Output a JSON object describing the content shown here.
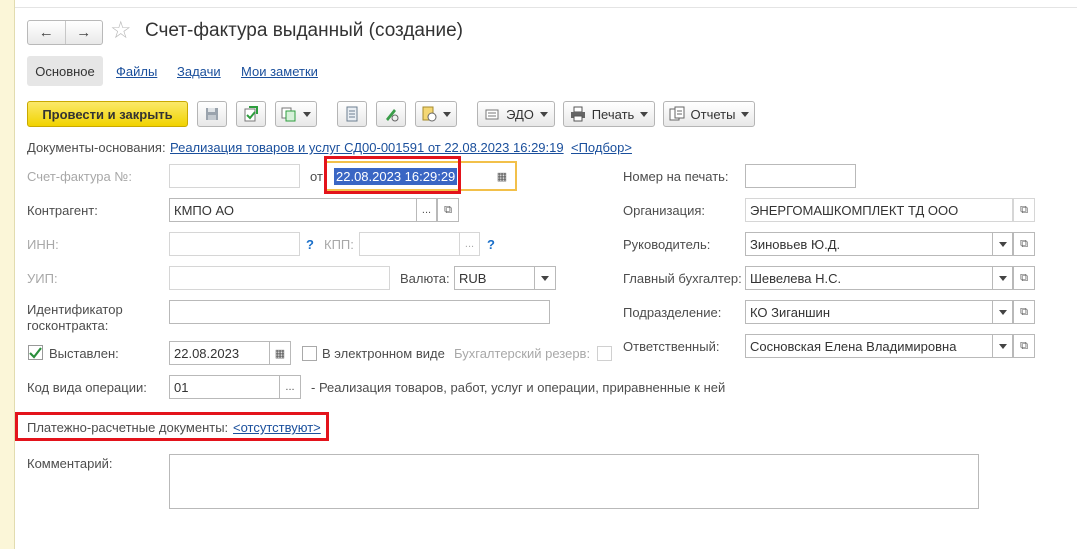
{
  "window": {
    "title": "Счет-фактура выданный (создание)"
  },
  "tabs": [
    "Основное",
    "Файлы",
    "Задачи",
    "Мои заметки"
  ],
  "toolbar": {
    "post_close": "Провести и закрыть",
    "edo": "ЭДО",
    "print": "Печать",
    "reports": "Отчеты"
  },
  "basis": {
    "label": "Документы-основания:",
    "link": "Реализация товаров и услуг СД00-001591 от 22.08.2023 16:29:19",
    "select": "<Подбор>"
  },
  "invoice": {
    "number_label": "Счет-фактура №:",
    "number_value": "",
    "from_label": "от",
    "date_value": "22.08.2023 16:29:29"
  },
  "counterparty": {
    "label": "Контрагент:",
    "value": "КМПО АО"
  },
  "inn": {
    "label": "ИНН:",
    "value": ""
  },
  "kpp": {
    "label": "КПП:",
    "value": ""
  },
  "uip": {
    "label": "УИП:",
    "value": ""
  },
  "currency": {
    "label": "Валюта:",
    "value": "RUB"
  },
  "contract_id": {
    "label": "Идентификатор госконтракта:",
    "value": ""
  },
  "issued": {
    "label": "Выставлен:",
    "checked": true,
    "date": "22.08.2023"
  },
  "electronic": {
    "label": "В электронном виде",
    "checked": false
  },
  "reserve": {
    "label": "Бухгалтерский резерв:",
    "checked": false
  },
  "operation": {
    "label": "Код вида операции:",
    "code": "01",
    "description": "- Реализация товаров, работ, услуг и операции, приравненные к ней"
  },
  "payment_docs": {
    "label": "Платежно-расчетные документы:",
    "link": "<отсутствуют>"
  },
  "comment": {
    "label": "Комментарий:",
    "value": ""
  },
  "right": {
    "print_number": {
      "label": "Номер на печать:",
      "value": ""
    },
    "organization": {
      "label": "Организация:",
      "value": "ЭНЕРГОМАШКОМПЛЕКТ ТД ООО"
    },
    "manager": {
      "label": "Руководитель:",
      "value": "Зиновьев Ю.Д."
    },
    "chief_accountant": {
      "label": "Главный бухгалтер:",
      "value": "Шевелева Н.С."
    },
    "department": {
      "label": "Подразделение:",
      "value": "КО Зиганшин"
    },
    "responsible": {
      "label": "Ответственный:",
      "value": "Сосновская Елена Владимировна"
    }
  },
  "colors": {
    "primary_button": "#f5d90c",
    "highlight_red": "#e3131b",
    "focus_orange": "#f2c04a",
    "link": "#1a4f9c"
  }
}
